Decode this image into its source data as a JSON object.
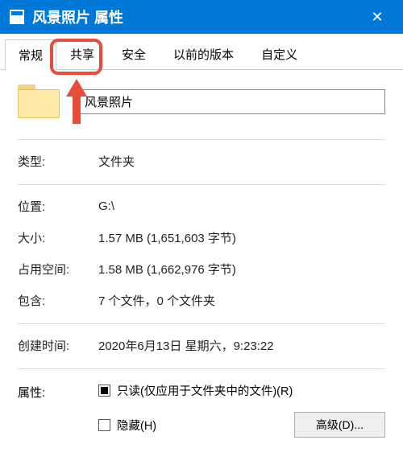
{
  "titlebar": {
    "title": "风景照片 属性",
    "close": "✕"
  },
  "tabs": {
    "general": "常规",
    "share": "共享",
    "security": "安全",
    "previous": "以前的版本",
    "custom": "自定义"
  },
  "folder": {
    "name": "风景照片"
  },
  "fields": {
    "type_label": "类型:",
    "type_value": "文件夹",
    "location_label": "位置:",
    "location_value": "G:\\",
    "size_label": "大小:",
    "size_value": "1.57 MB (1,651,603 字节)",
    "ondisk_label": "占用空间:",
    "ondisk_value": "1.58 MB (1,662,976 字节)",
    "contains_label": "包含:",
    "contains_value": "7 个文件，0 个文件夹",
    "created_label": "创建时间:",
    "created_value": "2020年6月13日 星期六，9:23:22"
  },
  "attributes": {
    "label": "属性:",
    "readonly": "只读(仅应用于文件夹中的文件)(R)",
    "hidden": "隐藏(H)",
    "advanced": "高级(D)..."
  }
}
